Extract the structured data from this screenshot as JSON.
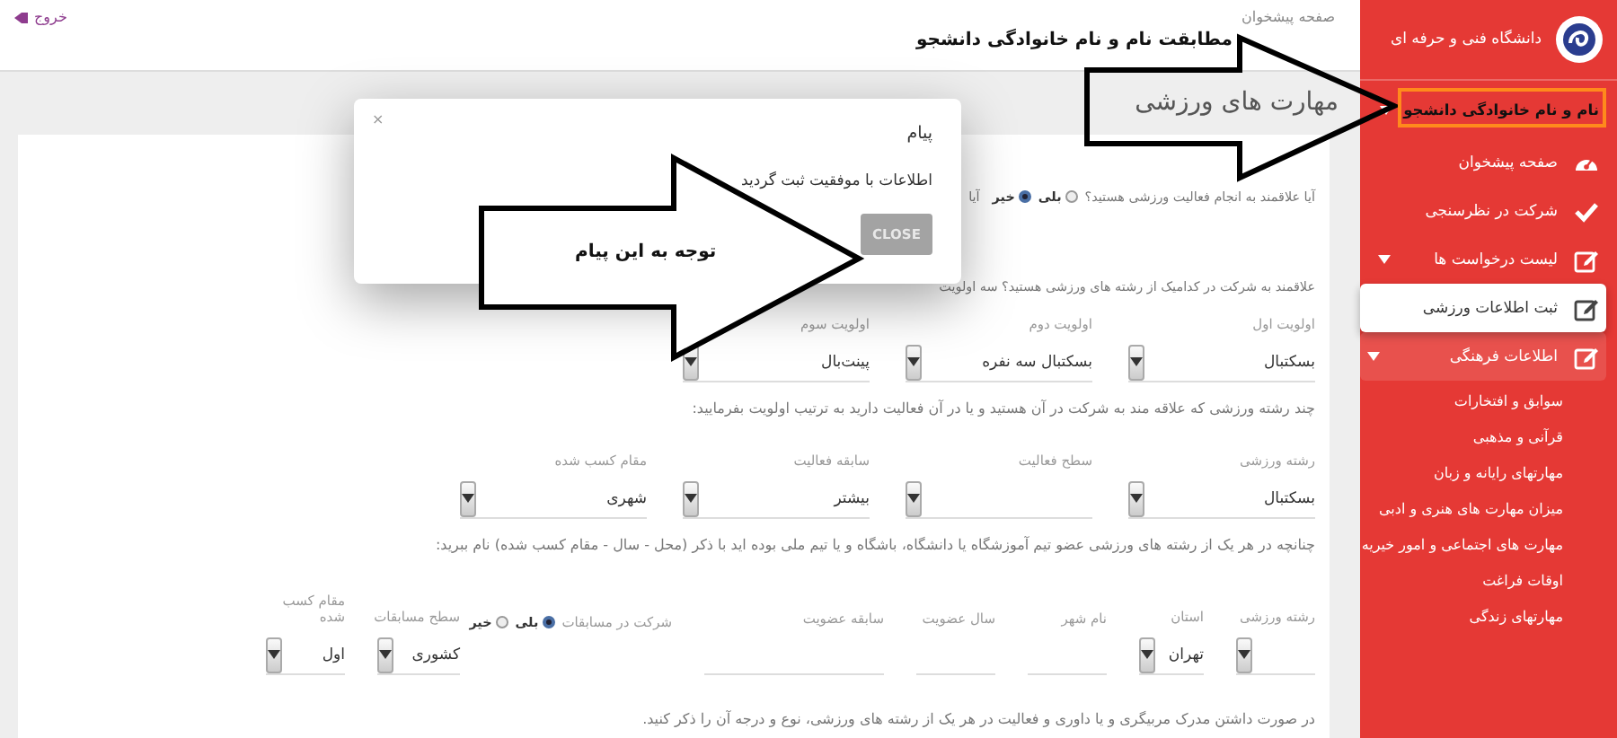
{
  "sidebar": {
    "university": "دانشگاه فنی و حرفه ای",
    "user_name": "نام و نام خانوادگی دانشجو",
    "menu": [
      {
        "label": "صفحه پیشخوان",
        "kind": "dashboard",
        "selected": false
      },
      {
        "label": "شرکت در نظرسنجی",
        "kind": "check",
        "selected": false
      },
      {
        "label": "لیست درخواست ها",
        "kind": "edit",
        "selected": false,
        "expanded": false
      },
      {
        "label": "ثبت اطلاعات ورزشی",
        "kind": "edit",
        "selected": true
      },
      {
        "label": "اطلاعات فرهنگی",
        "kind": "edit",
        "selected": false,
        "expanded": true,
        "children": [
          {
            "label": "سوابق و افتخارات"
          },
          {
            "label": "قرآنی و مذهبی"
          },
          {
            "label": "مهارتهای رایانه و زبان"
          },
          {
            "label": "میزان مهارت های هنری و ادبی"
          },
          {
            "label": "مهارت های اجتماعی و امور خیریه"
          },
          {
            "label": "اوقات فراغت"
          },
          {
            "label": "مهارتهای زندگی"
          }
        ]
      }
    ]
  },
  "header": {
    "breadcrumb": "صفحه پیشخوان",
    "logout": "خروج"
  },
  "page_title": "مهارت های ورزشی",
  "form": {
    "interest": {
      "question": "آیا علاقمند به انجام فعالیت ورزشی هستید؟",
      "options": [
        {
          "label": "بلی",
          "selected": false
        },
        {
          "label": "خیر",
          "selected": true
        }
      ]
    },
    "covered_question": "آیا",
    "priorities_question": "علاقمند به شرکت در کدامیک از رشته های ورزشی هستید؟ سه اولویت",
    "priorities": [
      {
        "label": "اولویت اول",
        "value": "بسکتبال"
      },
      {
        "label": "اولویت دوم",
        "value": "بسکتبال سه نفره"
      },
      {
        "label": "اولویت سوم",
        "value": "پینت‌بال"
      }
    ],
    "priorities_hint": "چند رشته ورزشی که علاقه مند به شرکت در آن هستید و یا در آن فعالیت دارید به ترتیب اولویت بفرمایید:",
    "activity": [
      {
        "label": "رشته ورزشی",
        "value": "بسکتبال"
      },
      {
        "label": "سطح فعالیت"
      },
      {
        "label": "سابقه فعالیت",
        "value": "بیشتر"
      },
      {
        "label": "مقام کسب شده",
        "value": "شهری"
      }
    ],
    "membership_hint": "چنانچه در هر یک از رشته های ورزشی عضو تیم آموزشگاه یا دانشگاه، باشگاه و یا تیم ملی بوده اید با ذکر (محل - سال - مقام کسب شده) نام ببرید:",
    "membership": [
      {
        "kind": "select",
        "label": "رشته ورزشی"
      },
      {
        "kind": "select",
        "label": "استان",
        "value": "تهران"
      },
      {
        "kind": "input",
        "label": "نام شهر"
      },
      {
        "kind": "input",
        "label": "سال عضویت"
      },
      {
        "kind": "input",
        "label": "سابقه عضویت"
      },
      {
        "kind": "radio",
        "label": "شرکت در مسابقات",
        "options": [
          {
            "label": "بلی",
            "selected": true
          },
          {
            "label": "خیر",
            "selected": false
          }
        ]
      },
      {
        "kind": "select",
        "label": "سطح مسابقات",
        "value": "کشوری"
      },
      {
        "kind": "select",
        "label": "مقام کسب شده",
        "value": "اول"
      }
    ],
    "coaching_hint": "در صورت داشتن مدرک مربیگری و یا داوری و فعالیت در هر یک از رشته های ورزشی، نوع و درجه آن را ذکر کنید."
  },
  "modal": {
    "title": "پیام",
    "close": "×",
    "message": "اطلاعات با موفقیت ثبت گردید",
    "button": "CLOSE"
  },
  "annotations": {
    "caption": "مطابقت نام و نام خانوادگی دانشجو",
    "arrow_text": "توجه به این پیام"
  }
}
